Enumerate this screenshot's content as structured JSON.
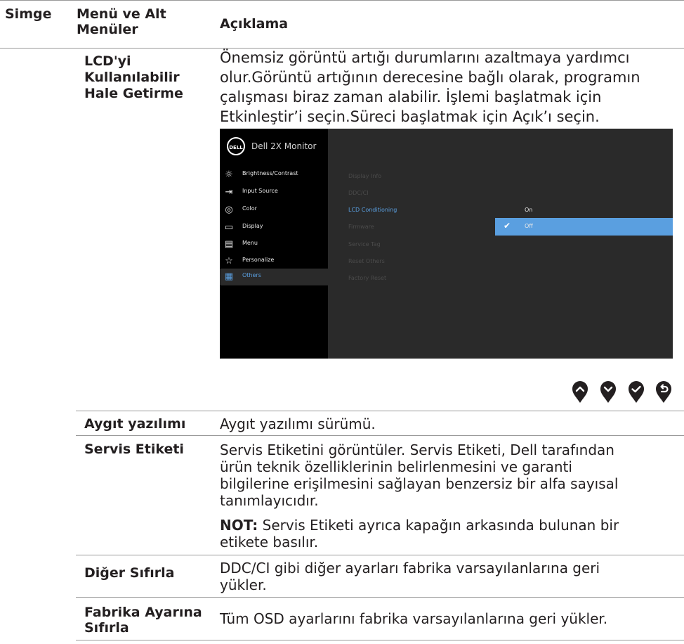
{
  "header": {
    "col_icon": "Simge",
    "col_menu": "Menü ve Alt Menüler",
    "col_desc": "Açıklama"
  },
  "lcd": {
    "label_lines": [
      "LCD'yi",
      "Kullanılabilir",
      "Hale Getirme"
    ],
    "desc_lines": [
      "Önemsiz görüntü artığı durumlarını azaltmaya yardımcı",
      "olur.Görüntü artığının derecesine bağlı olarak, programın",
      "çalışması biraz zaman alabilir. İşlemi başlatmak için",
      "Etkinleştir’i seçin.Süreci başlatmak için Açık’ı seçin."
    ]
  },
  "osd": {
    "logo": "DELL",
    "title": "Dell 2X Monitor",
    "menu": [
      {
        "icon": "brightness-icon",
        "glyph": "☼",
        "label": "Brightness/Contrast"
      },
      {
        "icon": "input-source-icon",
        "glyph": "⇥",
        "label": "Input Source"
      },
      {
        "icon": "color-icon",
        "glyph": "◎",
        "label": "Color"
      },
      {
        "icon": "display-icon",
        "glyph": "▭",
        "label": "Display"
      },
      {
        "icon": "menu-icon",
        "glyph": "▤",
        "label": "Menu"
      },
      {
        "icon": "star-icon",
        "glyph": "☆",
        "label": "Personalize"
      },
      {
        "icon": "others-icon",
        "glyph": "▦",
        "label": "Others"
      }
    ],
    "selected_menu": "Others",
    "submenu": [
      "Display Info",
      "DDC/CI",
      "LCD Conditioning",
      "Firmware",
      "Service Tag",
      "Reset Others",
      "Factory Reset"
    ],
    "active_submenu": "LCD Conditioning",
    "options": [
      "On",
      "Off"
    ],
    "selected_option": "Off",
    "colors": {
      "accent": "#5a9fe0",
      "panel": "#2a2a2a",
      "sidebar": "#000000"
    }
  },
  "nav_buttons": [
    "up-button",
    "down-button",
    "confirm-button",
    "back-button"
  ],
  "rows": [
    {
      "label_lines": [
        "Aygıt yazılımı"
      ],
      "desc_lines": [
        "Aygıt yazılımı sürümü."
      ]
    },
    {
      "label_lines": [
        "Servis Etiketi"
      ],
      "desc_lines": [
        "Servis Etiketini görüntüler. Servis Etiketi, Dell tarafından",
        "ürün teknik özelliklerinin belirlenmesini ve garanti",
        "bilgilerine erişilmesini sağlayan benzersiz bir alfa sayısal",
        "tanımlayıcıdır."
      ]
    },
    {
      "note_label": "NOT:",
      "note_lines": [
        " Servis Etiketi ayrıca kapağın arkasında bulunan bir",
        "etikete basılır."
      ]
    },
    {
      "label_lines": [
        "Diğer Sıfırla"
      ],
      "desc_lines": [
        "DDC/CI gibi diğer ayarları fabrika varsayılanlarına geri",
        "yükler."
      ]
    },
    {
      "label_lines": [
        "Fabrika Ayarına",
        "Sıfırla"
      ],
      "desc_lines": [
        "Tüm OSD ayarlarını fabrika varsayılanlarına geri yükler."
      ]
    }
  ]
}
